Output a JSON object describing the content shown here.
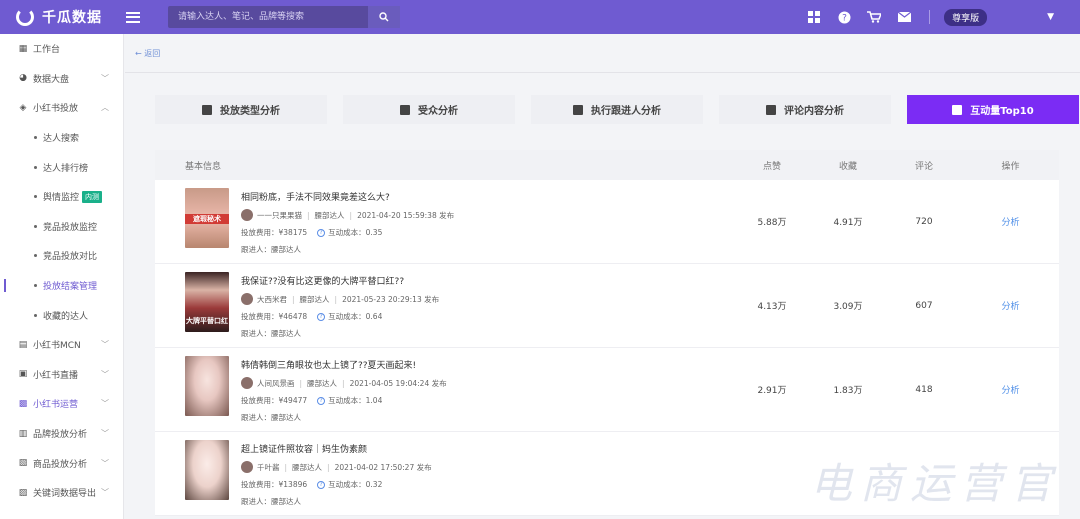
{
  "header": {
    "logo_text": "千瓜数据",
    "search_placeholder": "请输入达人、笔记、品牌等搜索",
    "edition": "尊享版"
  },
  "sidebar": {
    "items": [
      {
        "label": "工作台",
        "icon": "grid-icon"
      },
      {
        "label": "数据大盘",
        "icon": "pie-icon",
        "chevron": "﹀"
      },
      {
        "label": "小红书投放",
        "icon": "shield-icon",
        "chevron": "︿"
      },
      {
        "label": "达人搜索",
        "sub": true
      },
      {
        "label": "达人排行榜",
        "sub": true
      },
      {
        "label": "舆情监控",
        "sub": true,
        "badge": "内测"
      },
      {
        "label": "竞品投放监控",
        "sub": true
      },
      {
        "label": "竞品投放对比",
        "sub": true
      },
      {
        "label": "投放结案管理",
        "sub": true,
        "active": true
      },
      {
        "label": "收藏的达人",
        "sub": true
      },
      {
        "label": "小红书MCN",
        "icon": "building-icon",
        "chevron": "﹀"
      },
      {
        "label": "小红书直播",
        "icon": "video-icon",
        "chevron": "﹀"
      },
      {
        "label": "小红书运营",
        "icon": "chat-icon",
        "chevron": "﹀",
        "highlight": true
      },
      {
        "label": "品牌投放分析",
        "icon": "bar-chart-icon",
        "chevron": "﹀"
      },
      {
        "label": "商品投放分析",
        "icon": "goods-icon",
        "chevron": "﹀"
      },
      {
        "label": "关键词数据导出",
        "icon": "export-icon",
        "chevron": "﹀"
      }
    ]
  },
  "main": {
    "back_label": "← 返回",
    "tabs": [
      {
        "label": "投放类型分析",
        "width": 172
      },
      {
        "label": "受众分析",
        "width": 172
      },
      {
        "label": "执行跟进人分析",
        "width": 172
      },
      {
        "label": "评论内容分析",
        "width": 172
      },
      {
        "label": "互动量Top10",
        "width": 172,
        "active": true
      }
    ],
    "table": {
      "headers": {
        "info": "基本信息",
        "likes": "点赞",
        "collects": "收藏",
        "comments": "评论",
        "ops": "操作"
      },
      "rows": [
        {
          "title": "相同粉底，手法不同效果竟差这么大?",
          "author": "一一只果果猫",
          "level": "腰部达人",
          "time": "2021-04-20 15:59:38 发布",
          "cost": "投放费用：¥38175",
          "interact_cost": "互动成本：0.35",
          "follower": "跟进人：腰部达人",
          "likes": "5.88万",
          "collects": "4.91万",
          "comments": "720",
          "op": "分析",
          "thumb_label": "遮瑕秘术"
        },
        {
          "title": "我保证??没有比这更像的大牌平替口红??",
          "author": "大西米君",
          "level": "腰部达人",
          "time": "2021-05-23 20:29:13 发布",
          "cost": "投放费用：¥46478",
          "interact_cost": "互动成本：0.64",
          "follower": "跟进人：腰部达人",
          "likes": "4.13万",
          "collects": "3.09万",
          "comments": "607",
          "op": "分析",
          "thumb_label": "大牌平替口红"
        },
        {
          "title": "韩倩韩倒三角眼妆也太上镜了??夏天画起来!",
          "author": "人间风景画",
          "level": "腰部达人",
          "time": "2021-04-05 19:04:24 发布",
          "cost": "投放费用：¥49477",
          "interact_cost": "互动成本：1.04",
          "follower": "跟进人：腰部达人",
          "likes": "2.91万",
          "collects": "1.83万",
          "comments": "418",
          "op": "分析",
          "thumb_label": ""
        },
        {
          "title": "超上镜证件照妆容｜妈生伪素颜",
          "author": "千叶酱",
          "level": "腰部达人",
          "time": "2021-04-02 17:50:27 发布",
          "cost": "投放费用：¥13896",
          "interact_cost": "互动成本：0.32",
          "follower": "跟进人：腰部达人",
          "likes": "",
          "collects": "",
          "comments": "",
          "op": "",
          "thumb_label": ""
        }
      ]
    }
  },
  "watermark": "电商运营官",
  "colors": {
    "brand": "#6f5bd1",
    "active_tab": "#7b2cf4",
    "link": "#4f8fe8"
  }
}
